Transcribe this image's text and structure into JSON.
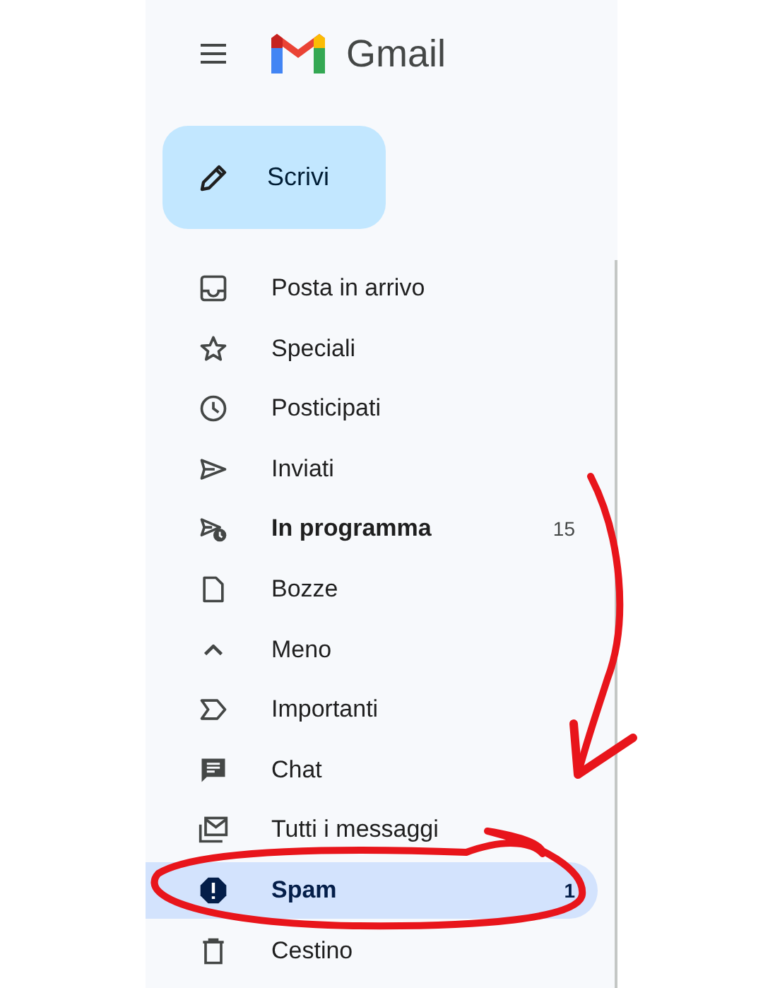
{
  "app": {
    "title": "Gmail"
  },
  "compose": {
    "label": "Scrivi"
  },
  "nav_items": [
    {
      "label": "Posta in arrivo",
      "unread": false,
      "selected": false
    },
    {
      "label": "Speciali",
      "unread": false,
      "selected": false
    },
    {
      "label": "Posticipati",
      "unread": false,
      "selected": false
    },
    {
      "label": "Inviati",
      "unread": false,
      "selected": false
    },
    {
      "label": "In programma",
      "count": "15",
      "unread": true,
      "selected": false
    },
    {
      "label": "Bozze",
      "unread": false,
      "selected": false
    },
    {
      "label": "Meno",
      "unread": false,
      "selected": false
    },
    {
      "label": "Importanti",
      "unread": false,
      "selected": false
    },
    {
      "label": "Chat",
      "unread": false,
      "selected": false
    },
    {
      "label": "Tutti i messaggi",
      "unread": false,
      "selected": false
    },
    {
      "label": "Spam",
      "count": "1",
      "unread": true,
      "selected": true
    },
    {
      "label": "Cestino",
      "unread": false,
      "selected": false
    }
  ]
}
